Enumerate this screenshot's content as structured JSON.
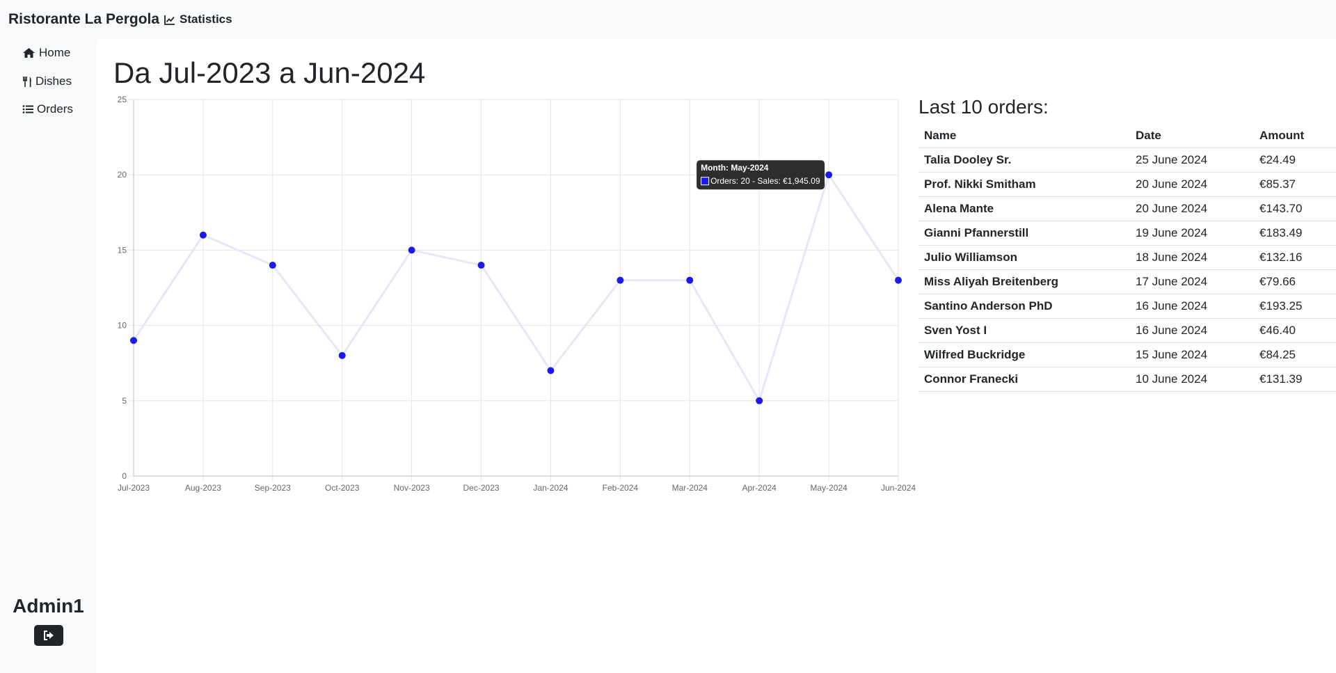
{
  "app": {
    "brand": "Ristorante La Pergola",
    "nav_statistics": "Statistics"
  },
  "sidebar": {
    "items": [
      {
        "label": "Home",
        "icon": "home-icon"
      },
      {
        "label": "Dishes",
        "icon": "utensils-icon"
      },
      {
        "label": "Orders",
        "icon": "list-icon"
      }
    ],
    "user": "Admin1",
    "logout_icon": "logout-icon"
  },
  "main": {
    "title": "Da Jul-2023 a Jun-2024"
  },
  "chart_data": {
    "type": "line",
    "categories": [
      "Jul-2023",
      "Aug-2023",
      "Sep-2023",
      "Oct-2023",
      "Nov-2023",
      "Dec-2023",
      "Jan-2024",
      "Feb-2024",
      "Mar-2024",
      "Apr-2024",
      "May-2024",
      "Jun-2024"
    ],
    "series": [
      {
        "values": [
          9,
          16,
          14,
          8,
          15,
          14,
          7,
          13,
          13,
          5,
          20,
          13
        ],
        "color": "#1a1aef",
        "line_color": "#e6e6fb"
      }
    ],
    "ylim": [
      0,
      25
    ],
    "yticks": [
      0,
      5,
      10,
      15,
      20,
      25
    ],
    "grid": true,
    "tooltip": {
      "category": "May-2024",
      "title": "Month: May-2024",
      "body": "Orders: 20 - Sales: €1,945.09"
    }
  },
  "orders": {
    "title": "Last 10 orders:",
    "headers": {
      "name": "Name",
      "date": "Date",
      "amount": "Amount"
    },
    "rows": [
      {
        "name": "Talia Dooley Sr.",
        "date": "25 June 2024",
        "amount": "€24.49"
      },
      {
        "name": "Prof. Nikki Smitham",
        "date": "20 June 2024",
        "amount": "€85.37"
      },
      {
        "name": "Alena Mante",
        "date": "20 June 2024",
        "amount": "€143.70"
      },
      {
        "name": "Gianni Pfannerstill",
        "date": "19 June 2024",
        "amount": "€183.49"
      },
      {
        "name": "Julio Williamson",
        "date": "18 June 2024",
        "amount": "€132.16"
      },
      {
        "name": "Miss Aliyah Breitenberg",
        "date": "17 June 2024",
        "amount": "€79.66"
      },
      {
        "name": "Santino Anderson PhD",
        "date": "16 June 2024",
        "amount": "€193.25"
      },
      {
        "name": "Sven Yost I",
        "date": "16 June 2024",
        "amount": "€46.40"
      },
      {
        "name": "Wilfred Buckridge",
        "date": "15 June 2024",
        "amount": "€84.25"
      },
      {
        "name": "Connor Franecki",
        "date": "10 June 2024",
        "amount": "€131.39"
      }
    ]
  }
}
